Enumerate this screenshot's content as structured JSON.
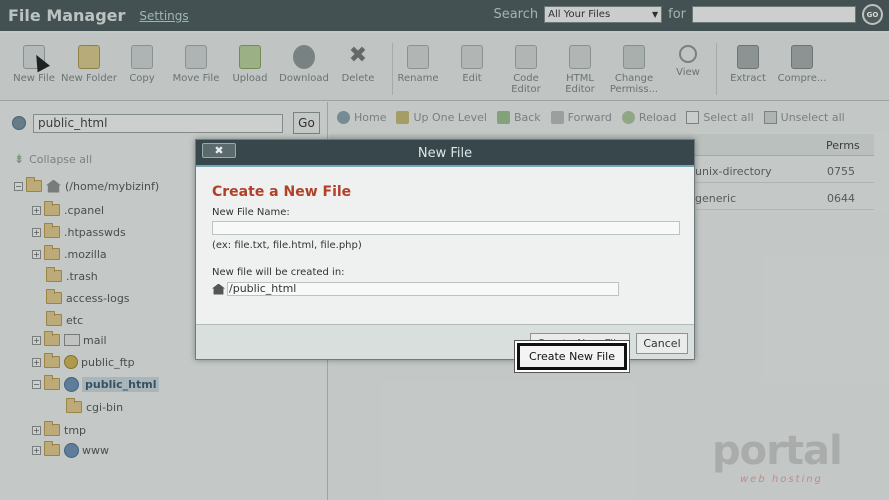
{
  "header": {
    "title": "File Manager",
    "settings_label": "Settings",
    "search_label": "Search",
    "search_scope": "All Your Files",
    "for_label": "for",
    "go_label": "GO"
  },
  "toolbar": {
    "items": [
      {
        "label": "New File"
      },
      {
        "label": "New Folder"
      },
      {
        "label": "Copy"
      },
      {
        "label": "Move File"
      },
      {
        "label": "Upload"
      },
      {
        "label": "Download"
      },
      {
        "label": "Delete"
      },
      {
        "label": "Rename"
      },
      {
        "label": "Edit"
      },
      {
        "label": "Code Editor"
      },
      {
        "label": "HTML Editor"
      },
      {
        "label": "Change Permiss..."
      },
      {
        "label": "View"
      },
      {
        "label": "Extract"
      },
      {
        "label": "Compre..."
      }
    ]
  },
  "left": {
    "path_value": "public_html",
    "go_label": "Go",
    "collapse_label": "Collapse all",
    "tree": [
      {
        "label": "(/home/mybizinf)"
      },
      {
        "label": ".cpanel"
      },
      {
        "label": ".htpasswds"
      },
      {
        "label": ".mozilla"
      },
      {
        "label": ".trash"
      },
      {
        "label": "access-logs"
      },
      {
        "label": "etc"
      },
      {
        "label": "mail"
      },
      {
        "label": "public_ftp"
      },
      {
        "label": "public_html"
      },
      {
        "label": "cgi-bin"
      },
      {
        "label": "tmp"
      },
      {
        "label": "www"
      }
    ]
  },
  "nav": {
    "home": "Home",
    "up": "Up One Level",
    "back": "Back",
    "forward": "Forward",
    "reload": "Reload",
    "select_all": "Select all",
    "unselect_all": "Unselect all"
  },
  "table": {
    "perms_header": "Perms",
    "rows": [
      {
        "type": "unix-directory",
        "perms": "0755"
      },
      {
        "type": "generic",
        "perms": "0644"
      }
    ]
  },
  "modal": {
    "close_label": "✖",
    "title": "New File",
    "heading": "Create a New File",
    "name_label": "New File Name:",
    "name_value": "",
    "example": "(ex: file.txt, file.html, file.php)",
    "location_label": "New file will be created in:",
    "location_value": "/public_html",
    "footer_ghost_label": "Create New File",
    "cancel_label": "Cancel",
    "create_label": "Create New File"
  },
  "watermark": {
    "main": "portal",
    "sub": "web hosting"
  },
  "colors": {
    "header_bg": "#4e5b5c",
    "modal_titlebar": "#37474b",
    "heading_red": "#b23f2a"
  }
}
